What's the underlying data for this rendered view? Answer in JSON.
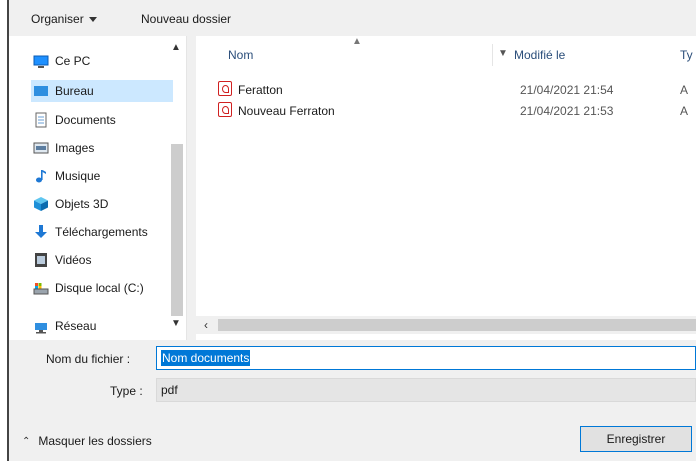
{
  "toolbar": {
    "organiser_label": "Organiser",
    "new_folder_label": "Nouveau dossier"
  },
  "nav": {
    "root": {
      "label": "Ce PC",
      "icon": "pc-icon"
    },
    "items": [
      {
        "label": "Bureau",
        "icon": "desktop-icon",
        "selected": true
      },
      {
        "label": "Documents",
        "icon": "documents-icon"
      },
      {
        "label": "Images",
        "icon": "images-icon"
      },
      {
        "label": "Musique",
        "icon": "music-icon"
      },
      {
        "label": "Objets 3D",
        "icon": "3d-objects-icon"
      },
      {
        "label": "Téléchargements",
        "icon": "downloads-icon"
      },
      {
        "label": "Vidéos",
        "icon": "videos-icon"
      },
      {
        "label": "Disque local (C:)",
        "icon": "drive-icon"
      }
    ],
    "network": {
      "label": "Réseau",
      "icon": "network-icon"
    }
  },
  "columns": {
    "name": "Nom",
    "modified": "Modifié le",
    "type": "Ty"
  },
  "files": [
    {
      "name": "Feratton",
      "modified": "21/04/2021 21:54",
      "type": "A",
      "icon": "pdf-icon"
    },
    {
      "name": "Nouveau Ferraton",
      "modified": "21/04/2021 21:53",
      "type": "A",
      "icon": "pdf-icon"
    }
  ],
  "form": {
    "filename_label": "Nom du fichier :",
    "filename_value": "Nom documents",
    "type_label": "Type :",
    "type_value": "pdf"
  },
  "footer": {
    "hide_folders_label": "Masquer les dossiers",
    "save_label": "Enregistrer"
  },
  "colors": {
    "selection_bg": "#cce8ff",
    "accent": "#0078d7",
    "pdf_red": "#d02020"
  }
}
